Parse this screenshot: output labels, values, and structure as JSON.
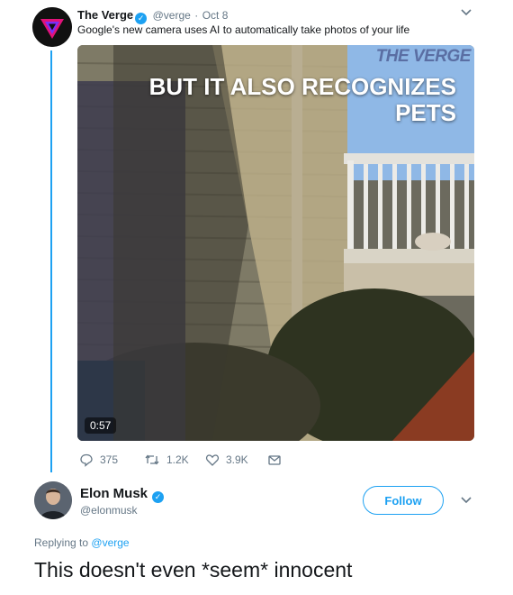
{
  "parent_tweet": {
    "author_name": "The Verge",
    "handle": "@verge",
    "separator": "·",
    "date": "Oct 8",
    "text": "Google's new camera uses AI to automatically take photos of your life",
    "media": {
      "brand_watermark": "THE VERGE",
      "headline_line1": "BUT IT ALSO RECOGNIZES",
      "headline_line2": "PETS",
      "duration": "0:57"
    },
    "actions": {
      "replies": "375",
      "retweets": "1.2K",
      "likes": "3.9K"
    }
  },
  "reply": {
    "author_name": "Elon Musk",
    "handle": "@elonmusk",
    "follow_label": "Follow",
    "replying_to_prefix": "Replying to",
    "replying_to_handle": "@verge",
    "text": "This doesn't even *seem* innocent"
  },
  "colors": {
    "accent": "#1da1f2",
    "muted": "#657786",
    "text": "#14171a"
  },
  "icons": [
    "verge-logo-icon",
    "verified-icon",
    "chevron-down-icon",
    "reply-icon",
    "retweet-icon",
    "like-icon",
    "message-icon"
  ]
}
